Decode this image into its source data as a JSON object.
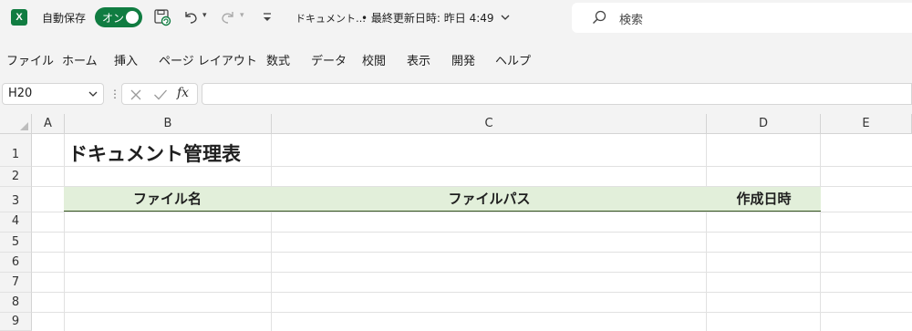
{
  "titlebar": {
    "app_icon": "X",
    "autosave_label": "自動保存",
    "autosave_state": "オン",
    "doc_name": "ドキュメント…",
    "saved_info": "• 最終更新日時: 昨日 4:49"
  },
  "search": {
    "placeholder": "検索"
  },
  "ribbon": {
    "tabs": [
      "ファイル",
      "ホーム",
      "挿入",
      "ページ レイアウト",
      "数式",
      "データ",
      "校閲",
      "表示",
      "開発",
      "ヘルプ"
    ]
  },
  "formula_bar": {
    "name_box": "H20",
    "fx_label": "fx",
    "formula": ""
  },
  "sheet": {
    "columns": [
      "A",
      "B",
      "C",
      "D",
      "E"
    ],
    "rows": [
      "1",
      "2",
      "3",
      "4",
      "5",
      "6",
      "7",
      "8",
      "9"
    ],
    "title": "ドキュメント管理表",
    "table_headers": [
      "ファイル名",
      "ファイルパス",
      "作成日時"
    ],
    "header_fill": "#e2efda",
    "header_border": "#385723"
  },
  "colors": {
    "accent": "#107c41"
  }
}
